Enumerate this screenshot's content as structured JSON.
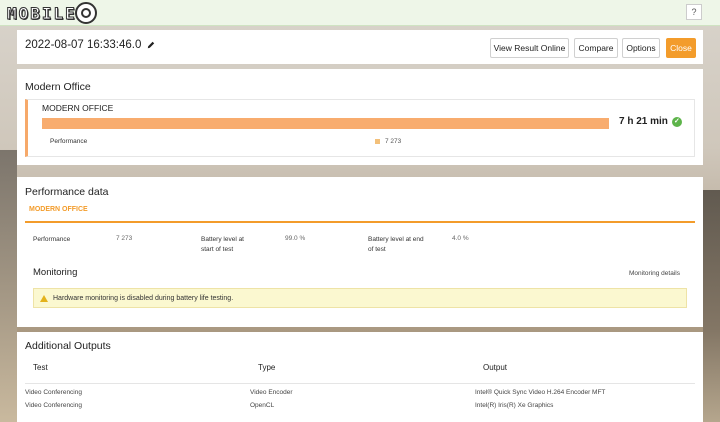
{
  "topbar": {
    "help_label": "?"
  },
  "logo": {
    "text": "MOBILE"
  },
  "header": {
    "timestamp": "2022-08-07 16:33:46.0",
    "buttons": {
      "view": "View Result Online",
      "compare": "Compare",
      "options": "Options",
      "close": "Close"
    }
  },
  "office": {
    "title": "Modern Office",
    "name": "MODERN OFFICE",
    "duration": "7 h 21 min",
    "performance_label": "Performance",
    "performance_value": "7 273"
  },
  "perf_data": {
    "title": "Performance data",
    "tab": "MODERN OFFICE",
    "performance_label": "Performance",
    "performance_value": "7 273",
    "battery_start_label_1": "Battery level at",
    "battery_start_label_2": "start of test",
    "battery_start_value": "99.0 %",
    "battery_end_label_1": "Battery level at end",
    "battery_end_label_2": "of test",
    "battery_end_value": "4.0 %"
  },
  "monitoring": {
    "title": "Monitoring",
    "details_link": "Monitoring details",
    "warning": "Hardware monitoring is disabled during battery life testing."
  },
  "additional": {
    "title": "Additional Outputs",
    "columns": [
      "Test",
      "Type",
      "Output"
    ],
    "rows": [
      [
        "Video Conferencing",
        "Video Encoder",
        "Intel® Quick Sync Video H.264 Encoder MFT"
      ],
      [
        "Video Conferencing",
        "OpenCL",
        "Intel(R) Iris(R) Xe Graphics"
      ]
    ]
  },
  "colors": {
    "accent": "#f39c2b",
    "bar": "#f8ac6e",
    "success": "#5db44a"
  }
}
